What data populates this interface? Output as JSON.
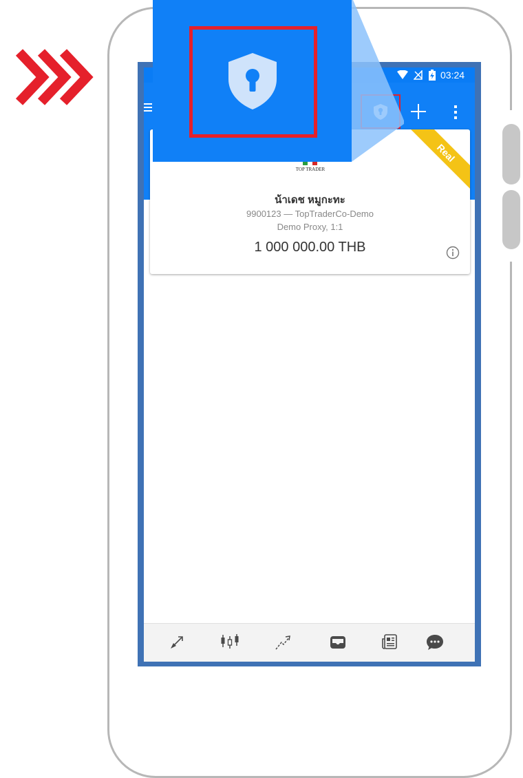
{
  "status_bar": {
    "time": "03:24"
  },
  "account_card": {
    "badge": "Real",
    "logo_text": "TOP TRADER",
    "name": "น้าเดช หมูกะทะ",
    "account_line": "9900123 — TopTraderCo-Demo",
    "server_line": "Demo Proxy, 1:1",
    "balance": "1 000 000.00 THB"
  },
  "colors": {
    "app_blue": "#1080f7",
    "highlight_red": "#e5202b",
    "badge_yellow": "#f4c316",
    "frame_blue": "#3f72b5"
  },
  "icons": {
    "appbar": [
      "menu-icon",
      "shield-lock-icon",
      "plus-icon",
      "more-vert-icon"
    ],
    "bottom_nav": [
      "trade-icon",
      "candlestick-icon",
      "chart-line-icon",
      "inbox-icon",
      "news-icon",
      "chat-icon"
    ],
    "status": [
      "wifi-icon",
      "no-signal-icon",
      "battery-charging-icon"
    ]
  }
}
